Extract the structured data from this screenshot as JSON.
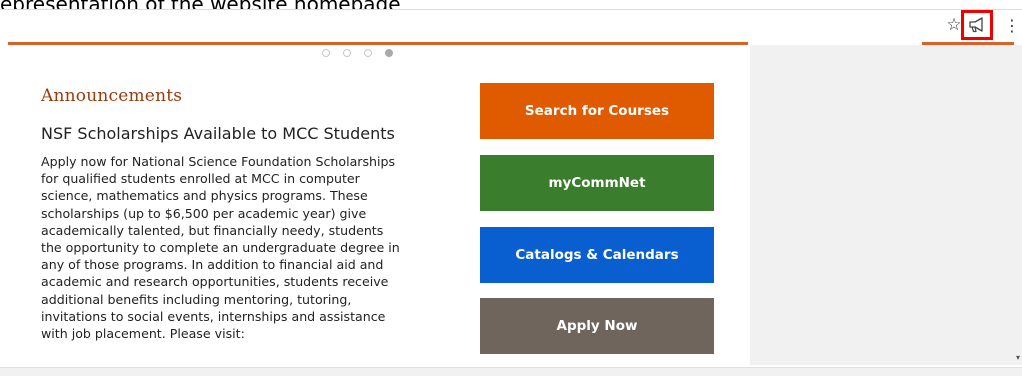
{
  "header_caption": "epresentation of the website homepage",
  "toolbar": {
    "star_icon": "star-icon",
    "announce_icon": "megaphone-icon",
    "menu_icon": "kebab-menu-icon",
    "highlight_color": "#ee0000"
  },
  "carousel": {
    "dots": [
      false,
      false,
      false,
      true
    ]
  },
  "announcements": {
    "heading": "Announcements",
    "title": "NSF Scholarships Available to MCC Students",
    "body_lines": [
      "Apply now for National Science Foundation Scholarships",
      "for qualified students enrolled at MCC in computer",
      "science, mathematics and physics programs. These",
      "scholarships (up to $6,500 per academic year) give",
      "academically talented, but financially needy, students",
      "the opportunity to complete an undergraduate degree in",
      "any of those programs. In addition to financial aid and",
      "academic and research opportunities, students receive",
      "additional benefits including mentoring, tutoring,",
      "invitations to social events, internships and assistance",
      "with job placement. Please visit:"
    ]
  },
  "buttons": {
    "search": {
      "label": "Search for Courses",
      "color": "#e05a00"
    },
    "commnet": {
      "label": "myCommNet",
      "color": "#3a7d2c"
    },
    "catalogs": {
      "label": "Catalogs & Calendars",
      "color": "#0a5fd0"
    },
    "apply": {
      "label": "Apply Now",
      "color": "#6f655c"
    }
  },
  "accent_color": "#d9622b"
}
